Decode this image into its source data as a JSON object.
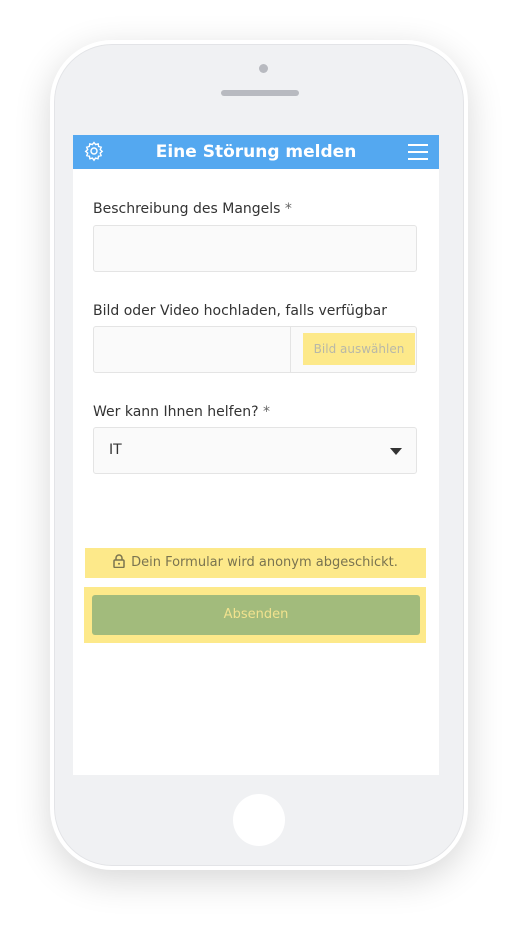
{
  "header": {
    "title": "Eine Störung melden",
    "settings_icon": "gear-icon",
    "menu_icon": "hamburger-menu-icon",
    "background_color": "#54a8f0"
  },
  "form": {
    "description": {
      "label": "Beschreibung des Mangels",
      "required_mark": "*",
      "value": ""
    },
    "upload": {
      "label": "Bild oder Video hochladen, falls verfügbar",
      "button_label": "Bild auswählen"
    },
    "helper": {
      "label": "Wer kann Ihnen helfen?",
      "required_mark": "*",
      "selected_value": "IT"
    }
  },
  "notice": {
    "icon": "lock-icon",
    "text": "Dein Formular wird anonym abgeschickt."
  },
  "submit": {
    "label": "Absenden"
  },
  "colors": {
    "highlight": "#fde98a",
    "submit_button": "#a2bb7c",
    "header": "#54a8f0"
  }
}
